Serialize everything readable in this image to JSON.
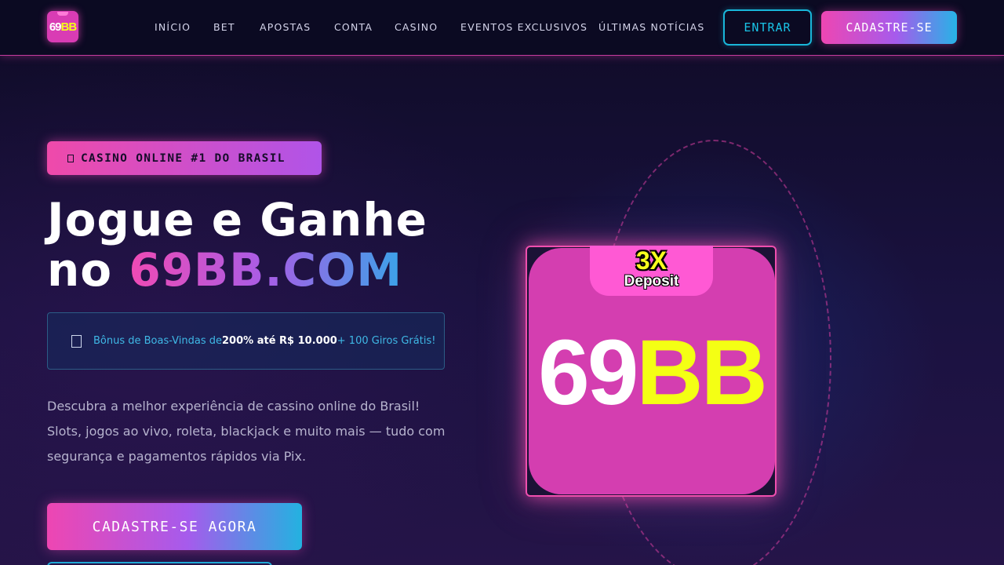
{
  "brand": {
    "logo_white": "69",
    "logo_yellow": "BB"
  },
  "nav": {
    "items": [
      "INÍCIO",
      "BET",
      "APOSTAS",
      "CONTA",
      "CASINO",
      "EVENTOS EXCLUSIVOS",
      "ÚLTIMAS NOTÍCIAS"
    ]
  },
  "header": {
    "login_label": "ENTRAR",
    "signup_label": "CADASTRE-SE"
  },
  "hero": {
    "badge": "CASINO ONLINE #1 DO BRASIL",
    "headline_line1": "Jogue e Ganhe",
    "headline_prefix": "no ",
    "headline_highlight": "69BB.COM",
    "bonus": {
      "part1": "Bônus de Boas-Vindas de ",
      "part2": "200% até R$ 10.000",
      "part3": " + 100 Giros Grátis!"
    },
    "description": "Descubra a melhor experiência de cassino online do Brasil! Slots, jogos ao vivo, roleta, blackjack e muito mais — tudo com segurança e pagamentos rápidos via Pix.",
    "cta_label": "CADASTRE-SE AGORA"
  },
  "promo_image": {
    "tag_big": "3X",
    "tag_small": "Deposit",
    "logo_white": "69",
    "logo_yellow": "BB"
  },
  "colors": {
    "accent_pink": "#ee46b2",
    "accent_purple": "#a65bec",
    "accent_cyan": "#19b6d9",
    "logo_yellow": "#f4ff14"
  },
  "icons": {
    "badge_icon": "star-icon",
    "bonus_icon": "gift-icon"
  }
}
